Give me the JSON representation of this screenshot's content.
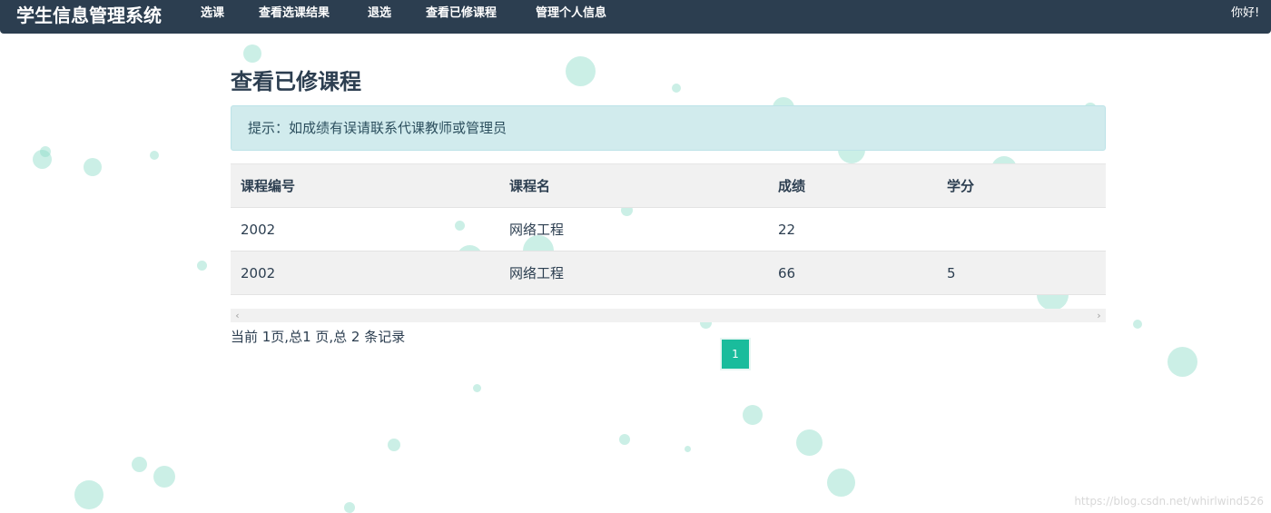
{
  "navbar": {
    "brand": "学生信息管理系统",
    "items": [
      "选课",
      "查看选课结果",
      "退选",
      "查看已修课程",
      "管理个人信息"
    ],
    "greeting": "你好!"
  },
  "main": {
    "title": "查看已修课程",
    "alert": "提示：如成绩有误请联系代课教师或管理员",
    "table": {
      "headers": [
        "课程编号",
        "课程名",
        "成绩",
        "学分"
      ],
      "rows": [
        [
          "2002",
          "网络工程",
          "22",
          ""
        ],
        [
          "2002",
          "网络工程",
          "66",
          "5"
        ]
      ]
    },
    "page_info": "当前 1页,总1 页,总 2 条记录",
    "pager": {
      "current": "1"
    }
  },
  "watermark": "https://blog.csdn.net/whirlwind526",
  "colors": {
    "navbar": "#2c3e50",
    "accent": "#1abc9c",
    "alert_bg": "#d1ebed"
  }
}
